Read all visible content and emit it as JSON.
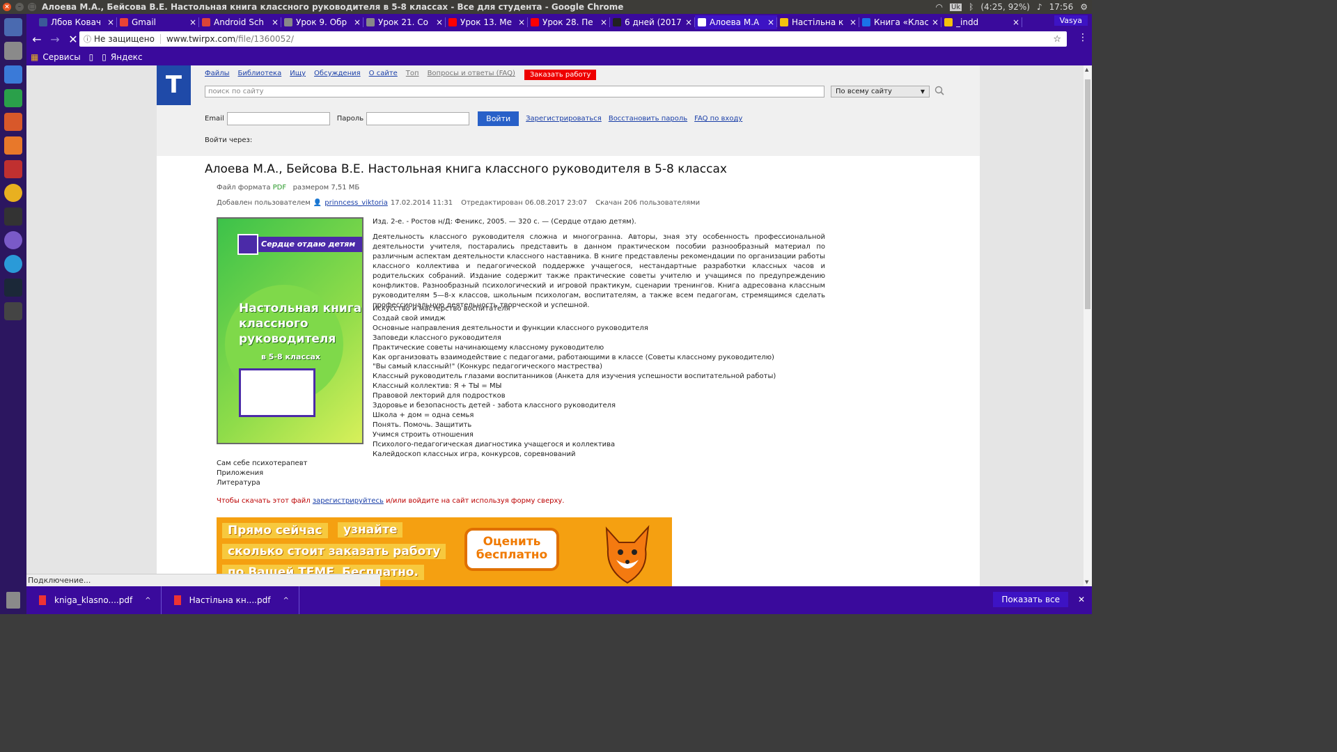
{
  "window": {
    "title": "Алоева М.А., Бейсова В.Е. Настольная книга классного руководителя в 5-8 классах - Все для студента - Google Chrome",
    "tray": {
      "lang": "Uk",
      "battery": "(4:25, 92%)",
      "time": "17:56"
    }
  },
  "tabs": [
    {
      "label": "Лбов Ковач",
      "color": "#3b5998"
    },
    {
      "label": "Gmail",
      "color": "#ea4335"
    },
    {
      "label": "Android Sch",
      "color": "#db4437"
    },
    {
      "label": "Урок 9. Обр",
      "color": "#888888"
    },
    {
      "label": "Урок 21. Со",
      "color": "#888888"
    },
    {
      "label": "Урок 13. Ме",
      "color": "#ff0000"
    },
    {
      "label": "Урок 28. Пе",
      "color": "#ff0000"
    },
    {
      "label": "6 дней (2017",
      "color": "#222222"
    },
    {
      "label": "Алоева М.А",
      "color": "#ffffff"
    },
    {
      "label": "Настільна к",
      "color": "#f4c20d"
    },
    {
      "label": "Книга «Клас",
      "color": "#1a73e8"
    },
    {
      "label": "_indd",
      "color": "#f4c20d"
    }
  ],
  "user": "Vasya",
  "omnibox": {
    "security": "Не защищено",
    "host": "www.twirpx.com",
    "path": "/file/1360052/"
  },
  "bookmarks": [
    "Сервисы",
    "",
    "Яндекс"
  ],
  "site": {
    "logo": "T",
    "nav": [
      "Файлы",
      "Библиотека",
      "Ищу",
      "Обсуждения",
      "О сайте",
      "Топ",
      "Вопросы и ответы (FAQ)"
    ],
    "order_button": "Заказать работу",
    "search_placeholder": "поиск по сайту",
    "scope": "По всему сайту",
    "email_label": "Email",
    "password_label": "Пароль",
    "login_button": "Войти",
    "register": "Зарегистрироваться",
    "restore": "Восстановить пароль",
    "faq_login": "FAQ по входу",
    "login_via": "Войти через:"
  },
  "file": {
    "title": "Алоева М.А., Бейсова В.Е. Настольная книга классного руководителя в 5-8 классах",
    "format_label": "Файл формата",
    "format": "PDF",
    "size": "размером 7,51 МБ",
    "added_by": "Добавлен пользователем",
    "user": "prinncess_viktoria",
    "added_date": "17.02.2014 11:31",
    "edited": "Отредактирован 06.08.2017 23:07",
    "downloads": "Скачан 206 пользователями",
    "edition": "Изд. 2-е. - Ростов н/Д: Феникс, 2005. — 320 с. — (Сердце отдаю детям).",
    "description": "Деятельность классного руководителя сложна и многогранна. Авторы, зная эту особенность профессиональной деятельности учителя, постарались представить в данном практическом пособии разнообразный материал по различным аспектам деятельности классного наставника. В книге представлены рекомендации по организации работы классного коллектива и педагогической поддержке учащегося, нестандартные разработки классных часов и родительских собраний. Издание содержит также практические советы учителю и учащимся по предупреждению конфликтов. Разнообразный психологический и игровой практикум, сценарии тренингов. Книга адресована классным руководителям 5—8-х классов, школьным психологам, воспитателям, а также всем педагогам, стремящимся сделать профессиональную деятельность творческой и успешной.",
    "toc": [
      "Искусство и мастерство воспитателя",
      "Создай свой имидж",
      "Основные направления деятельности и функции классного руководителя",
      "Заповеди классного руководителя",
      "Практические советы начинающему классному руководителю",
      "Как организовать взаимодействие с педагогами, работающими в классе (Советы классному руководителю)",
      "\"Вы самый классный!\" (Конкурс педагогического мастреcтва)",
      "Классный руководитель глазами воспитанников (Анкета для изучения успешности воспитательной работы)",
      "Классный коллектив: Я + ТЫ = МЫ",
      "Правовой лекторий для подростков",
      "Здоровье и безопасность детей - забота классного руководителя",
      "Школа + дом = одна семья",
      "Понять. Помочь. Защитить",
      "Учимся строить отношения",
      "Психолого-педагогическая диагностика учащегося и коллектива",
      "Калейдоскоп классных игра, конкурсов, соревнований"
    ],
    "toc2": [
      "Сам себе психотерапевт",
      "Приложения",
      "Литература"
    ],
    "warn_pre": "Чтобы скачать этот файл",
    "warn_link": "зарегистрируйтесь",
    "warn_post": "и/или войдите на сайт используя форму сверху."
  },
  "cover": {
    "series": "Сердце отдаю детям",
    "title_lines": [
      "Настольная книга",
      "классного",
      "руководителя"
    ],
    "subtitle": "в 5-8 классах"
  },
  "banner": {
    "l1a": "Прямо сейчас",
    "l1b": "узнайте",
    "l2": "сколько стоит заказать работу",
    "l3a": "по Вашей ТЕМЕ",
    "l3b": "Бесплатно.",
    "cta": "Оценить бесплатно"
  },
  "status": "Подключение...",
  "downloads_bar": {
    "items": [
      "kniga_klasno....pdf",
      "Настільна кн....pdf"
    ],
    "show_all": "Показать все"
  }
}
